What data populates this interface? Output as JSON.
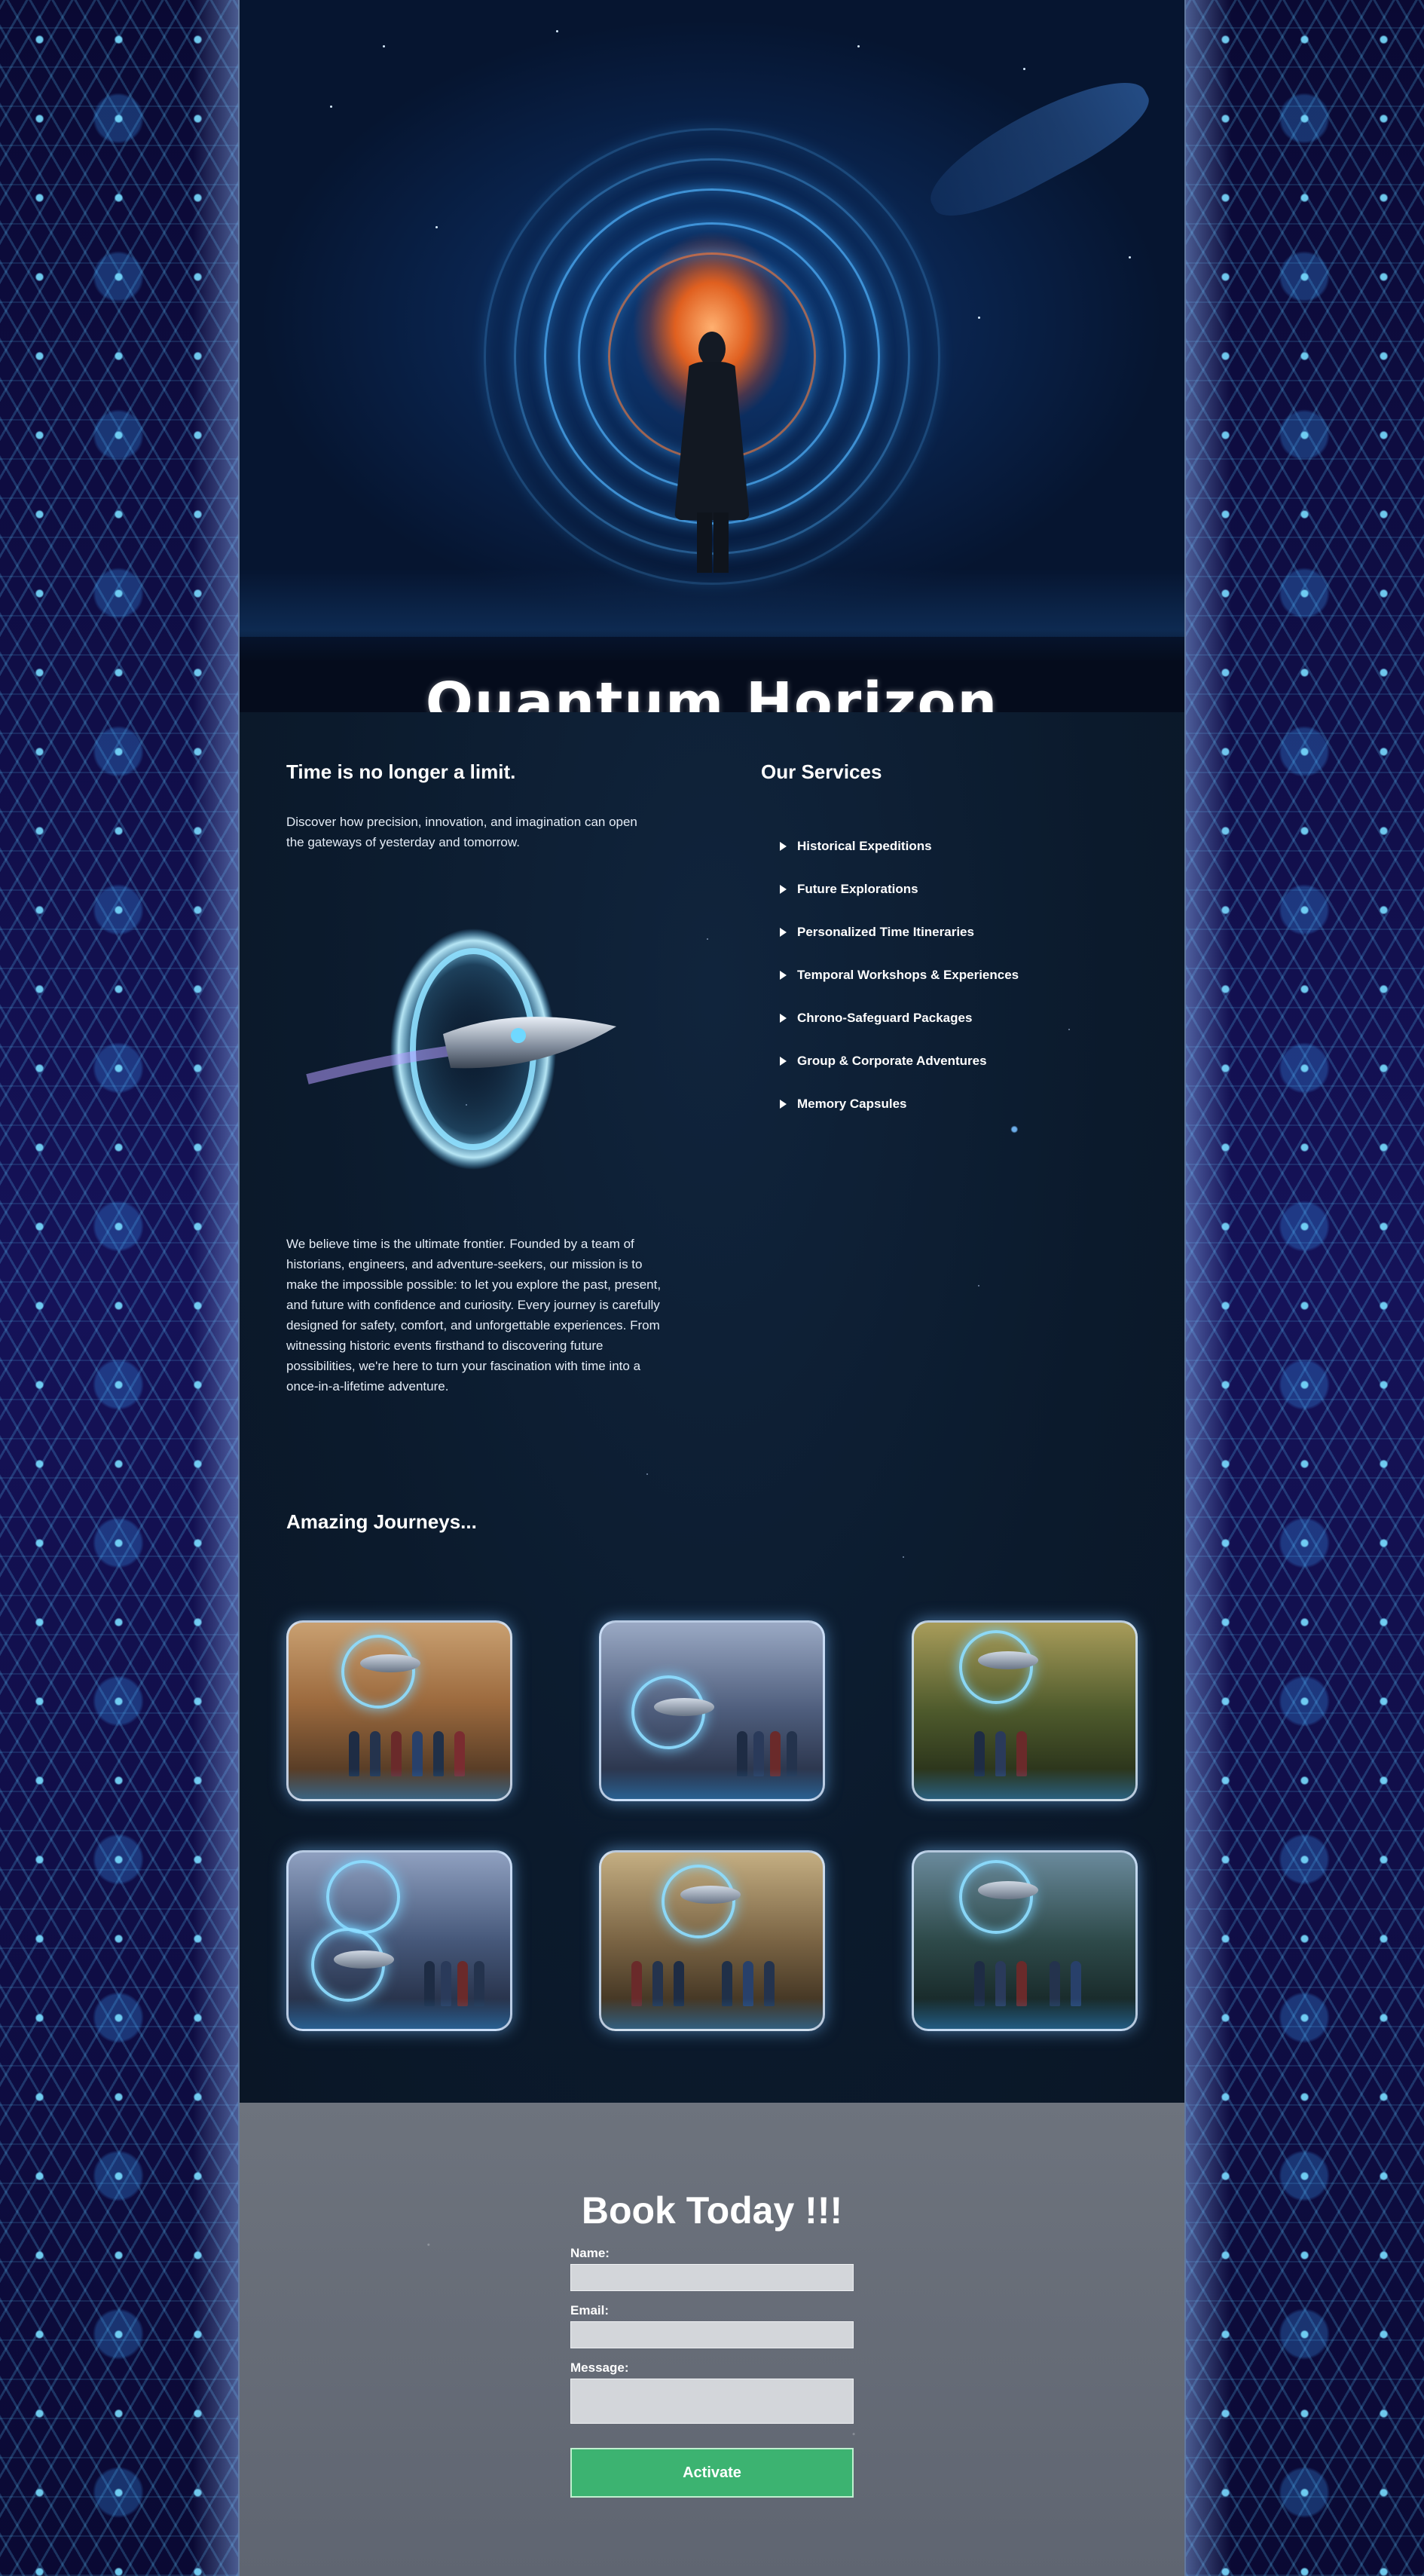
{
  "hero": {
    "title": "Quantum Horizon"
  },
  "intro": {
    "heading": "Time is no longer a limit.",
    "tagline": "Discover how precision, innovation, and imagination can open the gateways of yesterday and tomorrow.",
    "mission": "We believe time is the ultimate frontier. Founded by a team of historians, engineers, and adventure-seekers, our mission is to make the impossible possible: to let you explore the past, present, and future with confidence and curiosity. Every journey is carefully designed for safety, comfort, and unforgettable experiences. From witnessing historic events firsthand to discovering future possibilities, we're here to turn your fascination with time into a once-in-a-lifetime adventure."
  },
  "services": {
    "heading": "Our Services",
    "items": [
      "Historical Expeditions",
      "Future Explorations",
      "Personalized Time Itineraries",
      "Temporal Workshops & Experiences",
      "Chrono-Safeguard Packages",
      "Group & Corporate Adventures",
      "Memory Capsules"
    ]
  },
  "journeys": {
    "heading": "Amazing Journeys..."
  },
  "booking": {
    "title": "Book Today !!!",
    "name_label": "Name:",
    "email_label": "Email:",
    "message_label": "Message:",
    "submit_label": "Activate"
  },
  "colors": {
    "submit_button": "#3cb371",
    "panel": "#0c1a2b",
    "booking_panel": "#6b717b"
  }
}
